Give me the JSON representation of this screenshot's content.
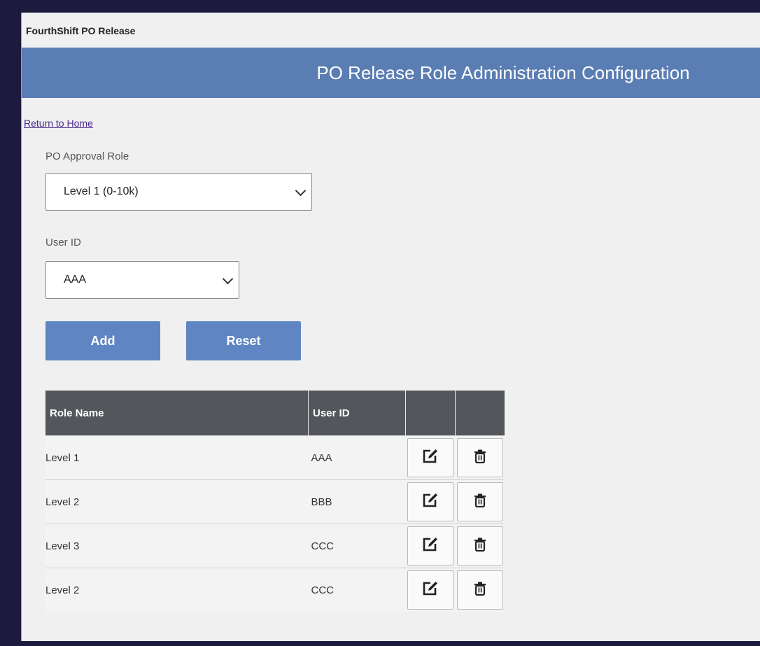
{
  "window": {
    "title": "FourthShift PO Release"
  },
  "banner": {
    "title": "PO Release Role Administration Configuration"
  },
  "nav": {
    "home_link": "Return to Home"
  },
  "form": {
    "role_label": "PO Approval Role",
    "role_value": "Level 1 (0-10k)",
    "user_label": "User ID",
    "user_value": "AAA",
    "add_label": "Add",
    "reset_label": "Reset"
  },
  "table": {
    "headers": [
      "Role Name",
      "User ID",
      "",
      ""
    ],
    "rows": [
      {
        "role": "Level 1",
        "user": "AAA"
      },
      {
        "role": "Level 2",
        "user": "BBB"
      },
      {
        "role": "Level 3",
        "user": "CCC"
      },
      {
        "role": "Level 2",
        "user": "CCC"
      }
    ],
    "row_icons": [
      "edit-icon",
      "trash-icon"
    ]
  },
  "colors": {
    "banner": "#5a7db3",
    "button": "#5f86c2",
    "table_header": "#53575c",
    "background": "#f0f0f0",
    "frame": "#1c1a3d"
  }
}
